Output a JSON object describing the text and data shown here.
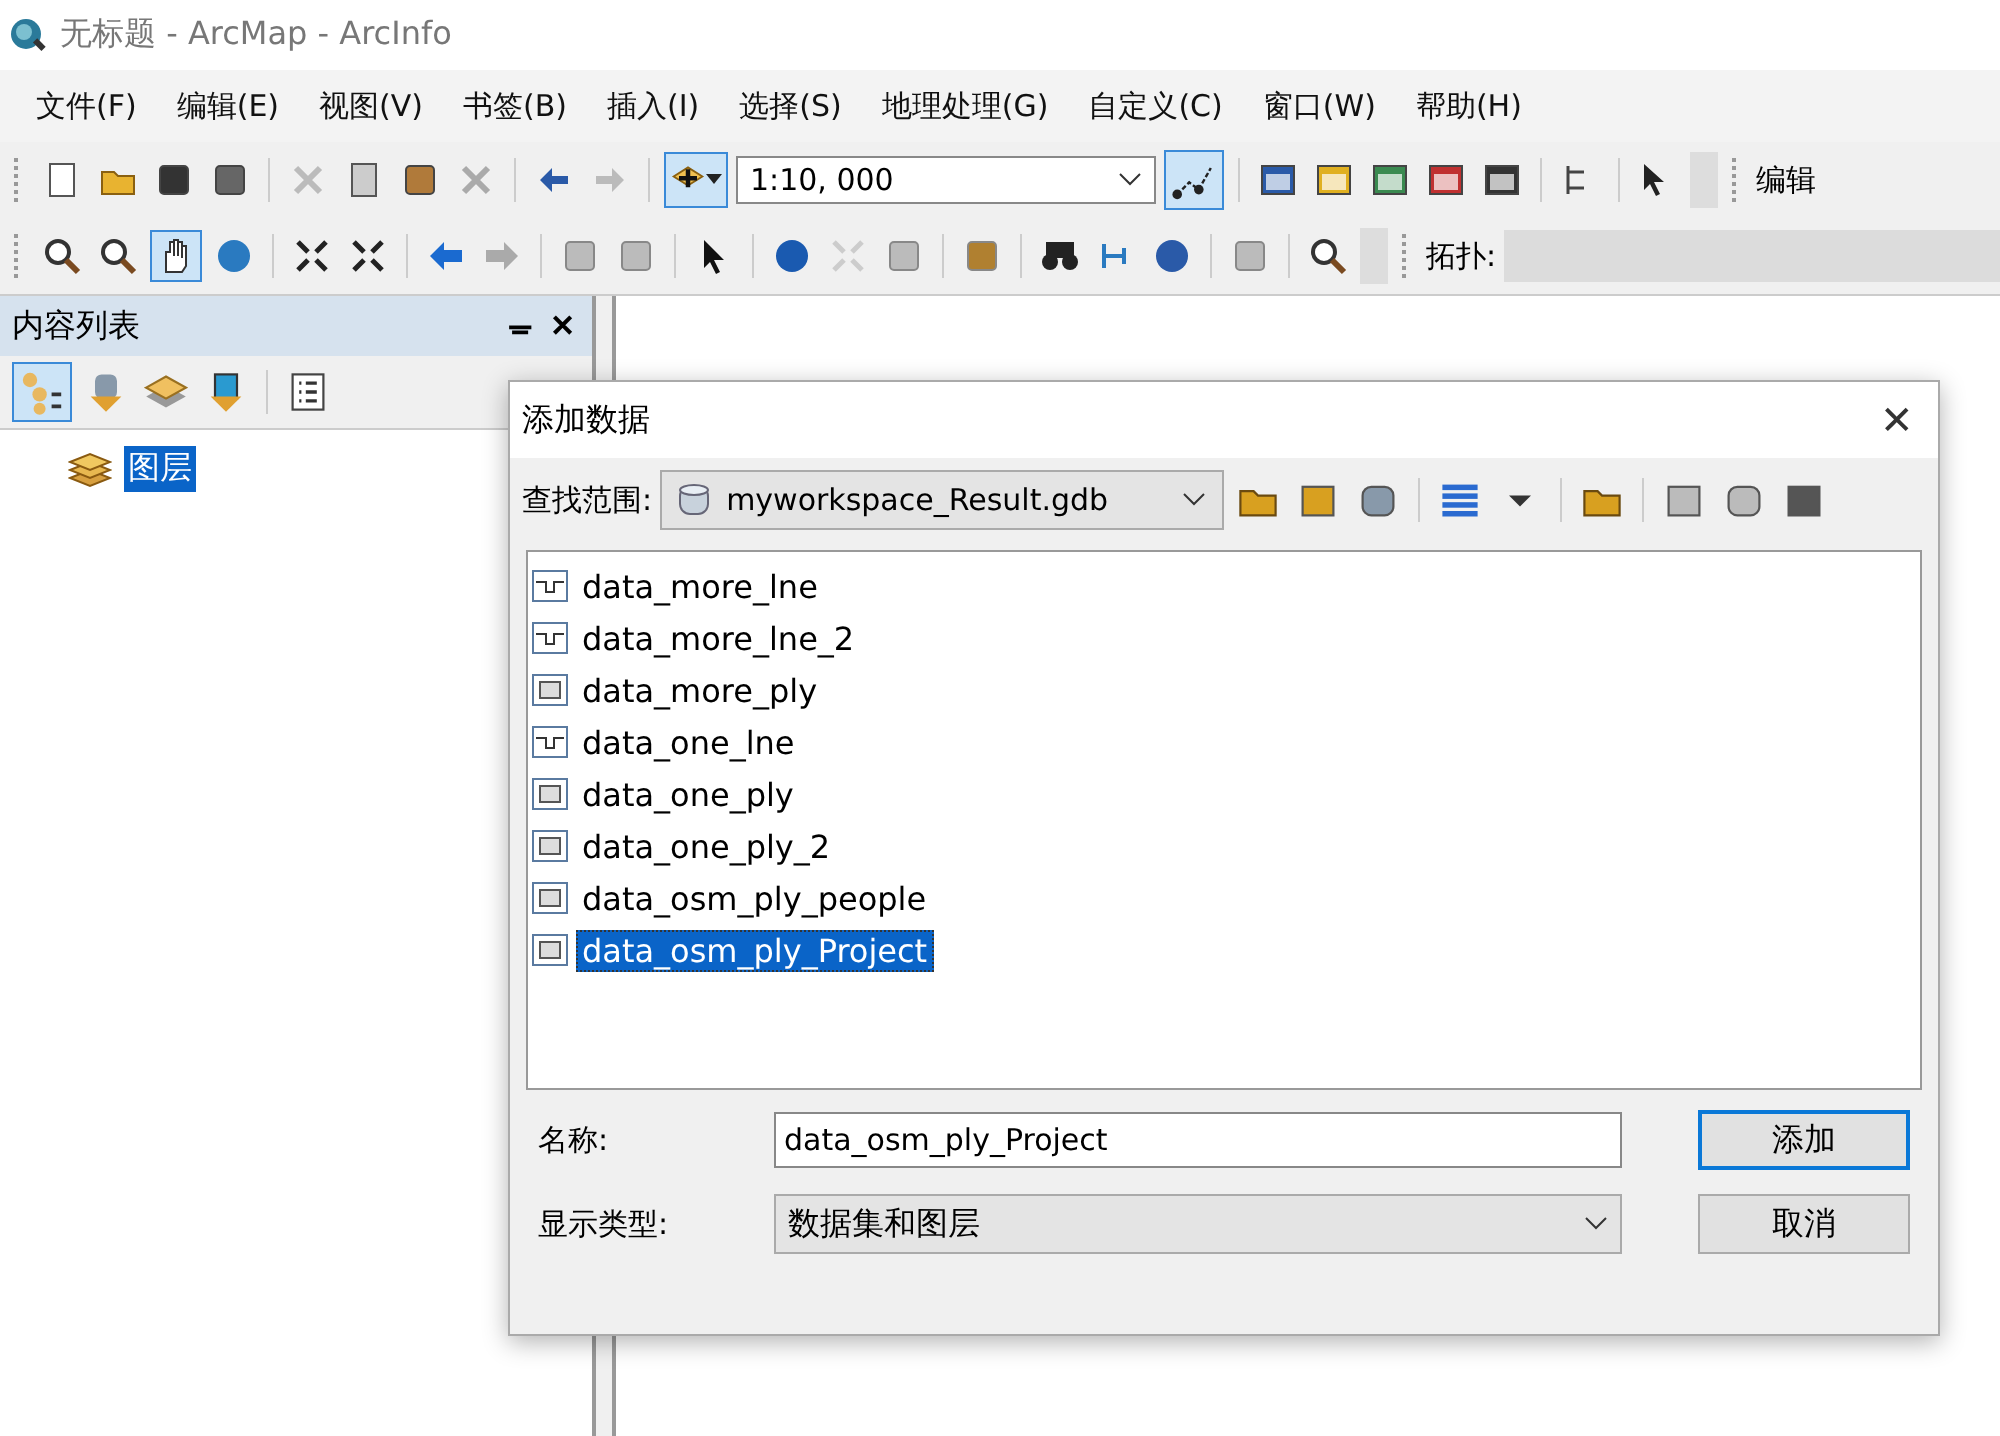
{
  "window": {
    "title": "无标题 - ArcMap - ArcInfo"
  },
  "menu": [
    "文件(F)",
    "编辑(E)",
    "视图(V)",
    "书签(B)",
    "插入(I)",
    "选择(S)",
    "地理处理(G)",
    "自定义(C)",
    "窗口(W)",
    "帮助(H)"
  ],
  "toolbar": {
    "scale": "1:10, 000",
    "editor_label": "编辑"
  },
  "toolbar2": {
    "topology_label": "拓扑:"
  },
  "toc": {
    "title": "内容列表",
    "pin": "ᚚ",
    "close": "✕",
    "layers": [
      {
        "label": "图层",
        "selected": true
      }
    ]
  },
  "dialog": {
    "title": "添加数据",
    "close": "✕",
    "look_in_label": "查找范围:",
    "look_in": "myworkspace_Result.gdb",
    "files": [
      {
        "name": "data_more_lne",
        "kind": "line",
        "selected": false
      },
      {
        "name": "data_more_lne_2",
        "kind": "line",
        "selected": false
      },
      {
        "name": "data_more_ply",
        "kind": "polygon",
        "selected": false
      },
      {
        "name": "data_one_lne",
        "kind": "line",
        "selected": false
      },
      {
        "name": "data_one_ply",
        "kind": "polygon",
        "selected": false
      },
      {
        "name": "data_one_ply_2",
        "kind": "polygon",
        "selected": false
      },
      {
        "name": "data_osm_ply_people",
        "kind": "polygon",
        "selected": false
      },
      {
        "name": "data_osm_ply_Project",
        "kind": "polygon",
        "selected": true
      }
    ],
    "name_label": "名称:",
    "name_value": "data_osm_ply_Project",
    "type_label": "显示类型:",
    "type_value": "数据集和图层",
    "add_button": "添加",
    "cancel_button": "取消"
  }
}
